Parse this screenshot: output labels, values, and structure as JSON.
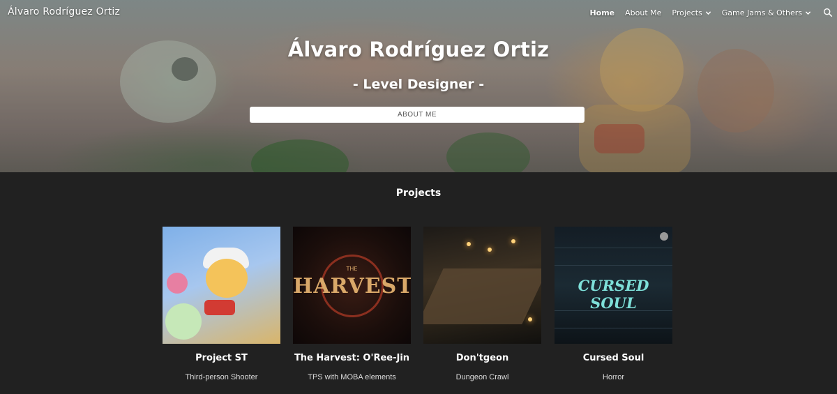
{
  "nav": {
    "site_title": "Álvaro Rodríguez Ortiz",
    "items": [
      {
        "label": "Home",
        "active": true,
        "dropdown": false
      },
      {
        "label": "About Me",
        "active": false,
        "dropdown": false
      },
      {
        "label": "Projects",
        "active": false,
        "dropdown": true
      },
      {
        "label": "Game Jams & Others",
        "active": false,
        "dropdown": true
      }
    ],
    "search_icon": "search-icon"
  },
  "hero": {
    "name": "Álvaro Rodríguez Ortiz",
    "role": "- Level Designer -",
    "button_label": "ABOUT ME"
  },
  "projects": {
    "title": "Projects",
    "items": [
      {
        "title": "Project ST",
        "subtitle": "Third-person Shooter"
      },
      {
        "title": "The Harvest: O'Ree-Jin",
        "subtitle": "TPS with MOBA elements",
        "thumb_the": "THE",
        "thumb_logo": "HARVEST"
      },
      {
        "title": "Don'tgeon",
        "subtitle": "Dungeon Crawl"
      },
      {
        "title": "Cursed Soul",
        "subtitle": "Horror",
        "thumb_logo": "CURSED SOUL"
      }
    ]
  },
  "colors": {
    "page_bg": "#212121",
    "text": "#ffffff",
    "button_bg": "#ffffff",
    "button_text": "#555555"
  }
}
